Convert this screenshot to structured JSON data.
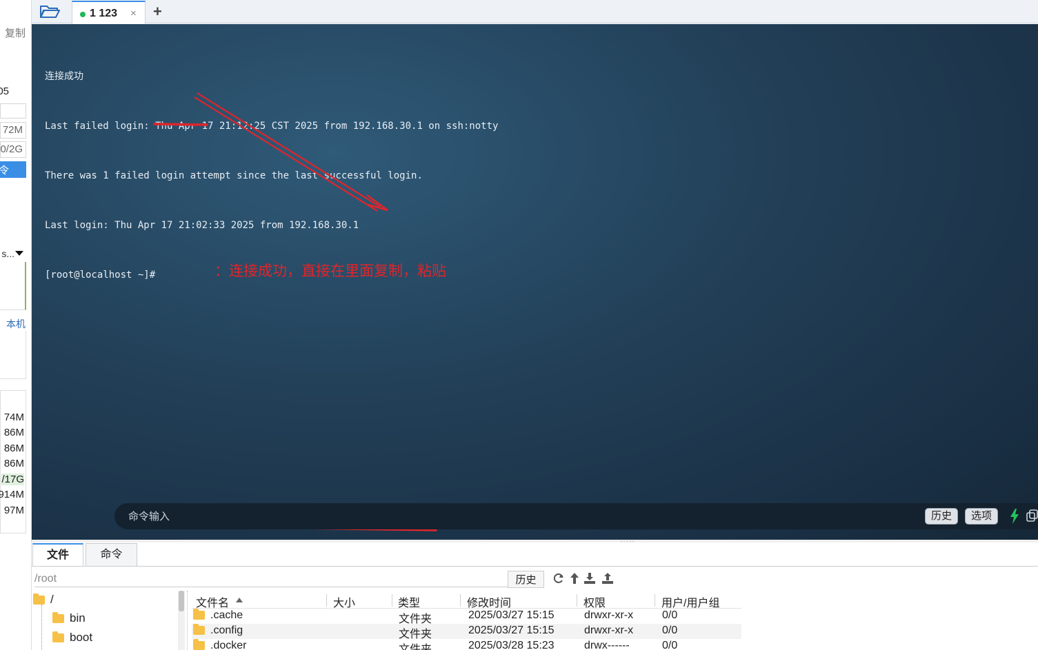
{
  "left_panel": {
    "copy_label": "复制",
    "num_05": "05",
    "mem_72m": "72M",
    "disk_0_2g": "0/2G",
    "cmd_char": "令",
    "dropdown_label": "s...",
    "local_label": "本机",
    "mem_list": [
      "74M",
      "86M",
      "86M",
      "86M",
      "/17G",
      "914M",
      "97M"
    ]
  },
  "tabs": {
    "session_label": "1 123",
    "close_glyph": "×",
    "add_glyph": "+"
  },
  "terminal": {
    "lines": [
      "连接成功",
      "Last failed login: Thu Apr 17 21:12:25 CST 2025 from 192.168.30.1 on ssh:notty",
      "There was 1 failed login attempt since the last successful login.",
      "Last login: Thu Apr 17 21:02:33 2025 from 192.168.30.1",
      "[root@localhost ~]#"
    ],
    "annotation": "：连接成功，直接在里面复制，粘贴"
  },
  "command_bar": {
    "placeholder": "命令输入",
    "history_label": "历史",
    "options_label": "选项"
  },
  "bottom": {
    "tab_files": "文件",
    "tab_commands": "命令",
    "path": "/root",
    "history_label": "历史",
    "tree": {
      "root": "/",
      "items": [
        "bin",
        "boot"
      ]
    },
    "columns": [
      "文件名",
      "大小",
      "类型",
      "修改时间",
      "权限",
      "用户/用户组"
    ],
    "files": [
      {
        "name": ".cache",
        "size": "",
        "type": "文件夹",
        "modified": "2025/03/27 15:15",
        "perm": "drwxr-xr-x",
        "owner": "0/0"
      },
      {
        "name": ".config",
        "size": "",
        "type": "文件夹",
        "modified": "2025/03/27 15:15",
        "perm": "drwxr-xr-x",
        "owner": "0/0"
      },
      {
        "name": ".docker",
        "size": "",
        "type": "文件夹",
        "modified": "2025/03/28 15:23",
        "perm": "drwx------",
        "owner": "0/0"
      }
    ]
  },
  "colors": {
    "annotation_red": "#e0252b",
    "online_green": "#1db954",
    "accent_blue": "#3a8ee6"
  }
}
